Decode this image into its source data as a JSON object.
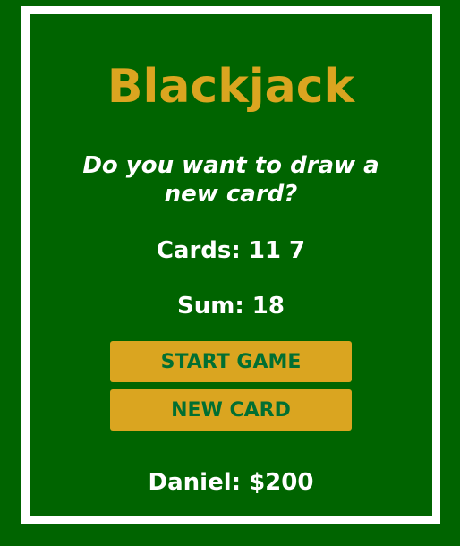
{
  "game": {
    "title": "Blackjack",
    "message": "Do you want to draw a new card?",
    "cards_text": "Cards: 11 7",
    "sum_text": "Sum: 18",
    "start_button_label": "START GAME",
    "new_card_button_label": "NEW CARD",
    "player_text": "Daniel: $200"
  },
  "colors": {
    "background": "#006400",
    "border": "#ffffff",
    "title": "#DAA520",
    "button_bg": "#DAA520",
    "button_text": "#016F32"
  }
}
